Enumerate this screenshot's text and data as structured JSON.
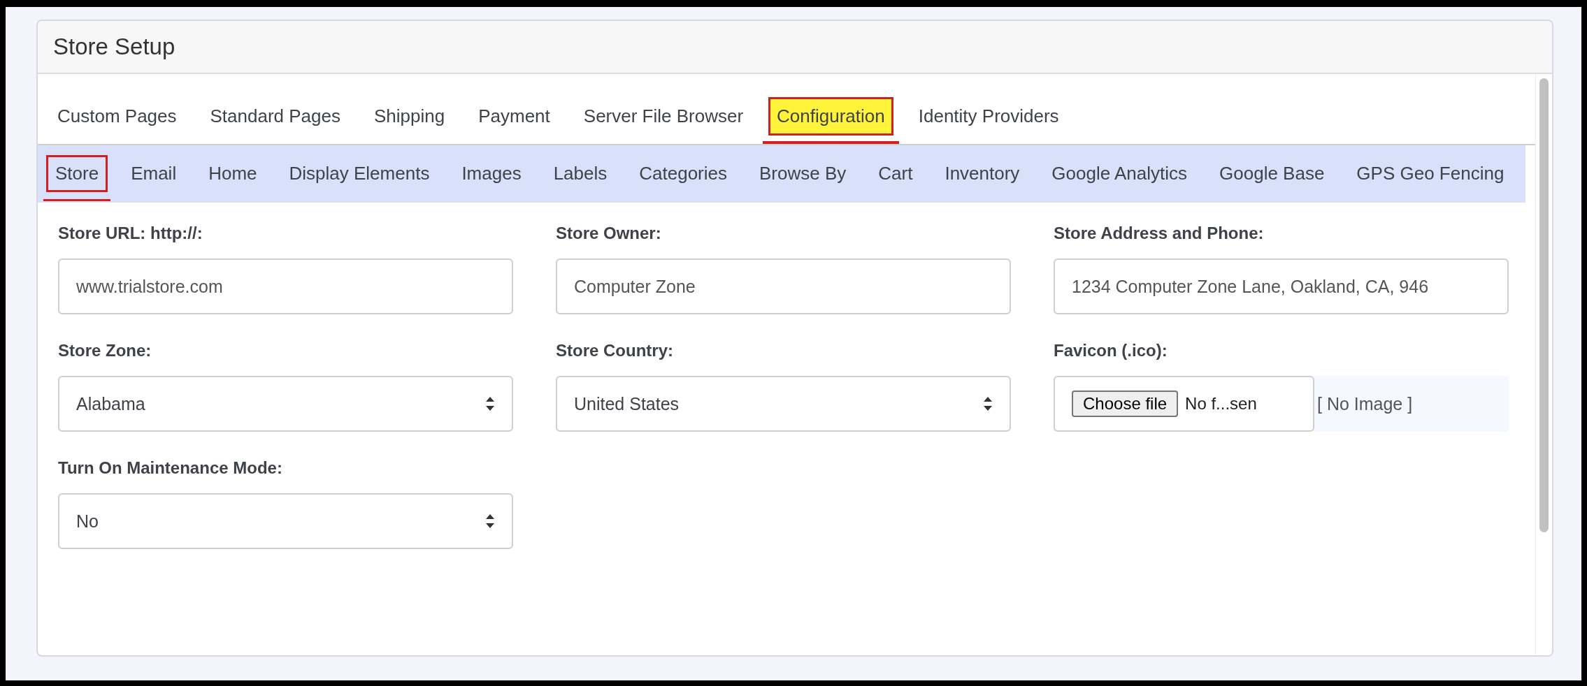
{
  "header": {
    "title": "Store Setup"
  },
  "tabs": [
    {
      "label": "Custom Pages",
      "selected": false,
      "highlighted": false
    },
    {
      "label": "Standard Pages",
      "selected": false,
      "highlighted": false
    },
    {
      "label": "Shipping",
      "selected": false,
      "highlighted": false
    },
    {
      "label": "Payment",
      "selected": false,
      "highlighted": false
    },
    {
      "label": "Server File Browser",
      "selected": false,
      "highlighted": false
    },
    {
      "label": "Configuration",
      "selected": true,
      "highlighted": true
    },
    {
      "label": "Identity Providers",
      "selected": false,
      "highlighted": false
    }
  ],
  "subtabs": [
    {
      "label": "Store",
      "selected": true
    },
    {
      "label": "Email",
      "selected": false
    },
    {
      "label": "Home",
      "selected": false
    },
    {
      "label": "Display Elements",
      "selected": false
    },
    {
      "label": "Images",
      "selected": false
    },
    {
      "label": "Labels",
      "selected": false
    },
    {
      "label": "Categories",
      "selected": false
    },
    {
      "label": "Browse By",
      "selected": false
    },
    {
      "label": "Cart",
      "selected": false
    },
    {
      "label": "Inventory",
      "selected": false
    },
    {
      "label": "Google Analytics",
      "selected": false
    },
    {
      "label": "Google Base",
      "selected": false
    },
    {
      "label": "GPS Geo Fencing",
      "selected": false
    }
  ],
  "fields": [
    {
      "kind": "text",
      "label": "Store URL: http://:",
      "value": "www.trialstore.com"
    },
    {
      "kind": "text",
      "label": "Store Owner:",
      "value": "Computer Zone"
    },
    {
      "kind": "text",
      "label": "Store Address and Phone:",
      "value": "1234 Computer Zone Lane, Oakland, CA, 946"
    },
    {
      "kind": "select",
      "label": "Store Zone:",
      "value": "Alabama"
    },
    {
      "kind": "select",
      "label": "Store Country:",
      "value": "United States"
    },
    {
      "kind": "file",
      "label": "Favicon (.ico):",
      "button": "Choose file",
      "file_name": "No f...sen",
      "preview": "[ No Image ]"
    },
    {
      "kind": "select",
      "label": "Turn On Maintenance Mode:",
      "value": "No"
    }
  ]
}
